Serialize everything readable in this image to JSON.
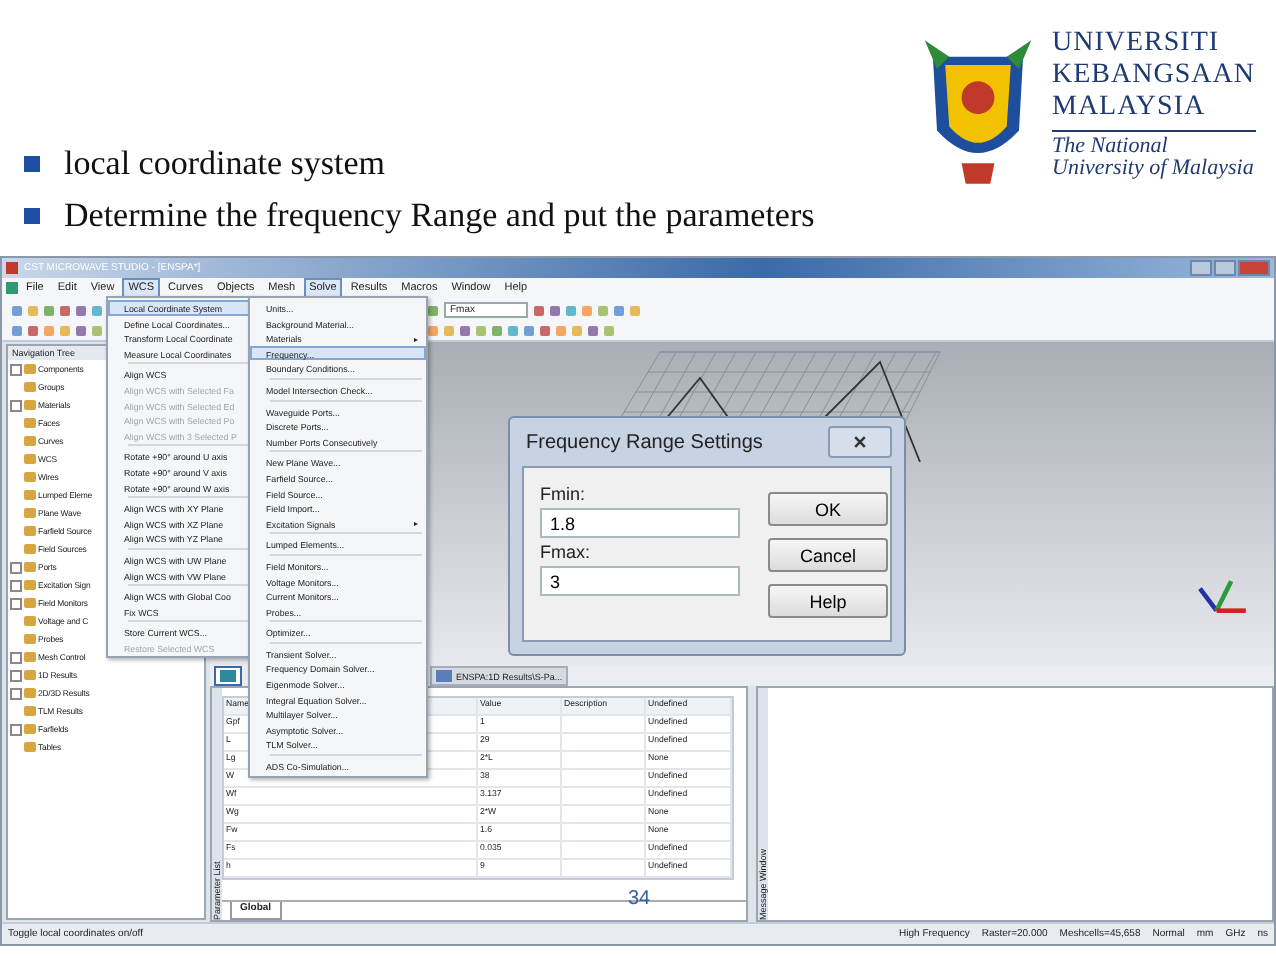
{
  "slide": {
    "bullets": [
      "local coordinate system",
      "Determine the frequency Range and put the parameters"
    ],
    "logo": {
      "lines": [
        "UNIVERSITI",
        "KEBANGSAAN",
        "MALAYSIA"
      ],
      "tagline": "The National University of Malaysia"
    },
    "page_number": "34"
  },
  "window": {
    "title": "CST MICROWAVE STUDIO - [ENSPA*]"
  },
  "menu_bar": [
    {
      "label": "File",
      "selected": false
    },
    {
      "label": "Edit",
      "selected": false
    },
    {
      "label": "View",
      "selected": false
    },
    {
      "label": "WCS",
      "selected": true
    },
    {
      "label": "Curves",
      "selected": false
    },
    {
      "label": "Objects",
      "selected": false
    },
    {
      "label": "Mesh",
      "selected": false
    },
    {
      "label": "Solve",
      "selected": true
    },
    {
      "label": "Results",
      "selected": false
    },
    {
      "label": "Macros",
      "selected": false
    },
    {
      "label": "Window",
      "selected": false
    },
    {
      "label": "Help",
      "selected": false
    }
  ],
  "toolbar": {
    "dropdown": "Fmax"
  },
  "wcs_menu": [
    {
      "kind": "item",
      "label": "Local Coordinate System",
      "selected": true,
      "disabled": false
    },
    {
      "kind": "item",
      "label": "Define Local Coordinates...",
      "selected": false,
      "disabled": false
    },
    {
      "kind": "item",
      "label": "Transform Local Coordinate",
      "selected": false,
      "disabled": false
    },
    {
      "kind": "item",
      "label": "Measure Local Coordinates",
      "selected": false,
      "disabled": false
    },
    {
      "kind": "separator"
    },
    {
      "kind": "item",
      "label": "Align WCS",
      "selected": false,
      "disabled": false
    },
    {
      "kind": "item",
      "label": "Align WCS with Selected Fa",
      "selected": false,
      "disabled": true
    },
    {
      "kind": "item",
      "label": "Align WCS with Selected Ed",
      "selected": false,
      "disabled": true
    },
    {
      "kind": "item",
      "label": "Align WCS with Selected Po",
      "selected": false,
      "disabled": true
    },
    {
      "kind": "item",
      "label": "Align WCS with 3 Selected P",
      "selected": false,
      "disabled": true
    },
    {
      "kind": "separator"
    },
    {
      "kind": "item",
      "label": "Rotate +90° around U axis",
      "selected": false,
      "disabled": false
    },
    {
      "kind": "item",
      "label": "Rotate +90° around V axis",
      "selected": false,
      "disabled": false
    },
    {
      "kind": "item",
      "label": "Rotate +90° around W axis",
      "selected": false,
      "disabled": false
    },
    {
      "kind": "separator"
    },
    {
      "kind": "item",
      "label": "Align WCS with XY Plane",
      "selected": false,
      "disabled": false
    },
    {
      "kind": "item",
      "label": "Align WCS with XZ Plane",
      "selected": false,
      "disabled": false
    },
    {
      "kind": "item",
      "label": "Align WCS with YZ Plane",
      "selected": false,
      "disabled": false
    },
    {
      "kind": "separator"
    },
    {
      "kind": "item",
      "label": "Align WCS with UW Plane",
      "selected": false,
      "disabled": false
    },
    {
      "kind": "item",
      "label": "Align WCS with VW Plane",
      "selected": false,
      "disabled": false
    },
    {
      "kind": "separator"
    },
    {
      "kind": "item",
      "label": "Align WCS with Global Coo",
      "selected": false,
      "disabled": false
    },
    {
      "kind": "item",
      "label": "Fix WCS",
      "selected": false,
      "disabled": false
    },
    {
      "kind": "separator"
    },
    {
      "kind": "item",
      "label": "Store Current WCS...",
      "selected": false,
      "disabled": false
    },
    {
      "kind": "item",
      "label": "Restore Selected WCS",
      "selected": false,
      "disabled": true
    }
  ],
  "solve_menu": [
    {
      "kind": "item",
      "label": "Units...",
      "selected": false
    },
    {
      "kind": "item",
      "label": "Background Material...",
      "selected": false
    },
    {
      "kind": "submenu",
      "label": "Materials",
      "selected": false
    },
    {
      "kind": "item",
      "label": "Frequency...",
      "selected": true
    },
    {
      "kind": "item",
      "label": "Boundary Conditions...",
      "selected": false
    },
    {
      "kind": "separator"
    },
    {
      "kind": "item",
      "label": "Model Intersection Check...",
      "selected": false
    },
    {
      "kind": "separator"
    },
    {
      "kind": "item",
      "label": "Waveguide Ports...",
      "selected": false
    },
    {
      "kind": "item",
      "label": "Discrete Ports...",
      "selected": false
    },
    {
      "kind": "item",
      "label": "Number Ports Consecutively",
      "selected": false
    },
    {
      "kind": "separator"
    },
    {
      "kind": "item",
      "label": "New Plane Wave...",
      "selected": false
    },
    {
      "kind": "item",
      "label": "Farfield Source...",
      "selected": false
    },
    {
      "kind": "item",
      "label": "Field Source...",
      "selected": false
    },
    {
      "kind": "item",
      "label": "Field Import...",
      "selected": false
    },
    {
      "kind": "submenu",
      "label": "Excitation Signals",
      "selected": false
    },
    {
      "kind": "separator"
    },
    {
      "kind": "item",
      "label": "Lumped Elements...",
      "selected": false
    },
    {
      "kind": "separator"
    },
    {
      "kind": "item",
      "label": "Field Monitors...",
      "selected": false
    },
    {
      "kind": "item",
      "label": "Voltage Monitors...",
      "selected": false
    },
    {
      "kind": "item",
      "label": "Current Monitors...",
      "selected": false
    },
    {
      "kind": "item",
      "label": "Probes...",
      "selected": false
    },
    {
      "kind": "separator"
    },
    {
      "kind": "item",
      "label": "Optimizer...",
      "selected": false
    },
    {
      "kind": "separator"
    },
    {
      "kind": "item",
      "label": "Transient Solver...",
      "selected": false
    },
    {
      "kind": "item",
      "label": "Frequency Domain Solver...",
      "selected": false
    },
    {
      "kind": "item",
      "label": "Eigenmode Solver...",
      "selected": false
    },
    {
      "kind": "item",
      "label": "Integral Equation Solver...",
      "selected": false
    },
    {
      "kind": "item",
      "label": "Multilayer Solver...",
      "selected": false
    },
    {
      "kind": "item",
      "label": "Asymptotic Solver...",
      "selected": false
    },
    {
      "kind": "item",
      "label": "TLM Solver...",
      "selected": false
    },
    {
      "kind": "separator"
    },
    {
      "kind": "item",
      "label": "ADS Co-Simulation...",
      "selected": false
    }
  ],
  "navigation_tree": {
    "title": "Navigation Tree",
    "items": [
      {
        "label": "Components",
        "kind": "group"
      },
      {
        "label": "Groups",
        "kind": "leaf"
      },
      {
        "label": "Materials",
        "kind": "group"
      },
      {
        "label": "Faces",
        "kind": "leaf"
      },
      {
        "label": "Curves",
        "kind": "leaf"
      },
      {
        "label": "WCS",
        "kind": "leaf"
      },
      {
        "label": "Wires",
        "kind": "leaf"
      },
      {
        "label": "Lumped Eleme",
        "kind": "leaf"
      },
      {
        "label": "Plane Wave",
        "kind": "leaf"
      },
      {
        "label": "Farfield Source",
        "kind": "leaf"
      },
      {
        "label": "Field Sources",
        "kind": "leaf"
      },
      {
        "label": "Ports",
        "kind": "group"
      },
      {
        "label": "Excitation Sign",
        "kind": "group"
      },
      {
        "label": "Field Monitors",
        "kind": "group"
      },
      {
        "label": "Voltage and C",
        "kind": "leaf"
      },
      {
        "label": "Probes",
        "kind": "leaf"
      },
      {
        "label": "Mesh Control",
        "kind": "group"
      },
      {
        "label": "1D Results",
        "kind": "group"
      },
      {
        "label": "2D/3D Results",
        "kind": "group"
      },
      {
        "label": "TLM Results",
        "kind": "leaf"
      },
      {
        "label": "Farfields",
        "kind": "group"
      },
      {
        "label": "Tables",
        "kind": "leaf"
      }
    ]
  },
  "dialog": {
    "title": "Frequency Range Settings",
    "fields": [
      {
        "label": "Fmin:",
        "value": "1.8"
      },
      {
        "label": "Fmax:",
        "value": "3"
      }
    ],
    "buttons": [
      "OK",
      "Cancel",
      "Help"
    ]
  },
  "tabs": [
    {
      "selected": true
    },
    {
      "label": "ENSPA:1D Results\\S-Pa...",
      "selected": false
    }
  ],
  "parameter_list": {
    "title": "Parameter List",
    "columns": [
      "Name",
      "Value",
      "Description",
      "Undefined"
    ],
    "rows": [
      {
        "name": "Gpf",
        "value": "1",
        "type": "Undefined"
      },
      {
        "name": "L",
        "value": "29",
        "type": "Undefined"
      },
      {
        "name": "Lg",
        "value": "2*L",
        "type": "None"
      },
      {
        "name": "W",
        "value": "38",
        "type": "Undefined"
      },
      {
        "name": "Wf",
        "value": "3.137",
        "type": "Undefined"
      },
      {
        "name": "Wg",
        "value": "2*W",
        "type": "None"
      },
      {
        "name": "Fw",
        "value": "1.6",
        "type": "None"
      },
      {
        "name": "Fs",
        "value": "0.035",
        "type": "Undefined"
      },
      {
        "name": "h",
        "value": "9",
        "type": "Undefined"
      }
    ],
    "tab": "Global"
  },
  "message_window": {
    "title": "Message Window"
  },
  "status_bar": {
    "message": "Toggle local coordinates on/off",
    "fields": [
      "High Frequency",
      "Raster=20.000",
      "Meshcells=45,658",
      "Normal",
      "mm",
      "GHz",
      "ns"
    ]
  }
}
